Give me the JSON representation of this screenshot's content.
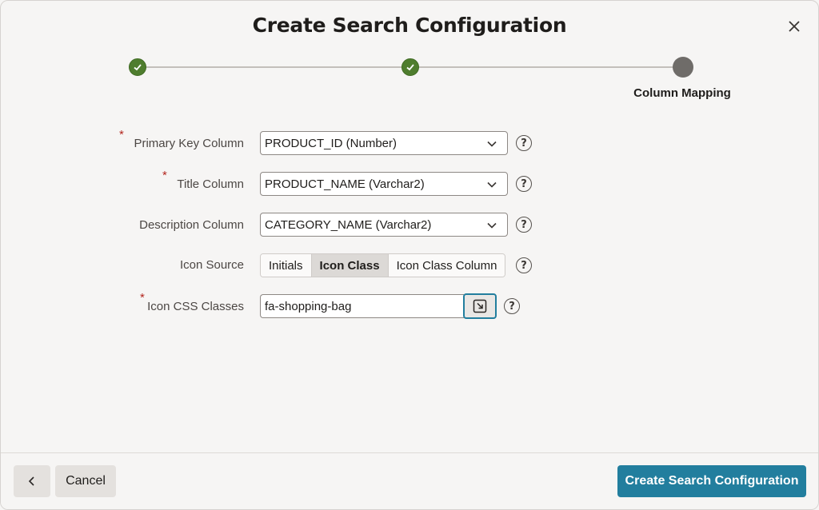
{
  "dialog": {
    "title": "Create Search Configuration",
    "close_icon": "close-icon"
  },
  "progress": {
    "steps": [
      {
        "state": "complete"
      },
      {
        "state": "complete"
      },
      {
        "state": "current",
        "label": "Column Mapping"
      }
    ]
  },
  "form": {
    "primary_key": {
      "label": "Primary Key Column",
      "required": true,
      "value": "PRODUCT_ID (Number)"
    },
    "title_column": {
      "label": "Title Column",
      "required": true,
      "value": "PRODUCT_NAME (Varchar2)"
    },
    "description_column": {
      "label": "Description Column",
      "required": false,
      "value": "CATEGORY_NAME (Varchar2)"
    },
    "icon_source": {
      "label": "Icon Source",
      "options": [
        "Initials",
        "Icon Class",
        "Icon Class Column"
      ],
      "selected": "Icon Class"
    },
    "icon_css_classes": {
      "label": "Icon CSS Classes",
      "required": true,
      "value": "fa-shopping-bag"
    },
    "required_marker": "*",
    "help_glyph": "?"
  },
  "footer": {
    "back_icon": "chevron-left-icon",
    "cancel_label": "Cancel",
    "primary_label": "Create Search Configuration"
  },
  "colors": {
    "accent": "#227e9e",
    "complete": "#4f7d2e",
    "current": "#6f6c69",
    "required": "#b3261e"
  }
}
